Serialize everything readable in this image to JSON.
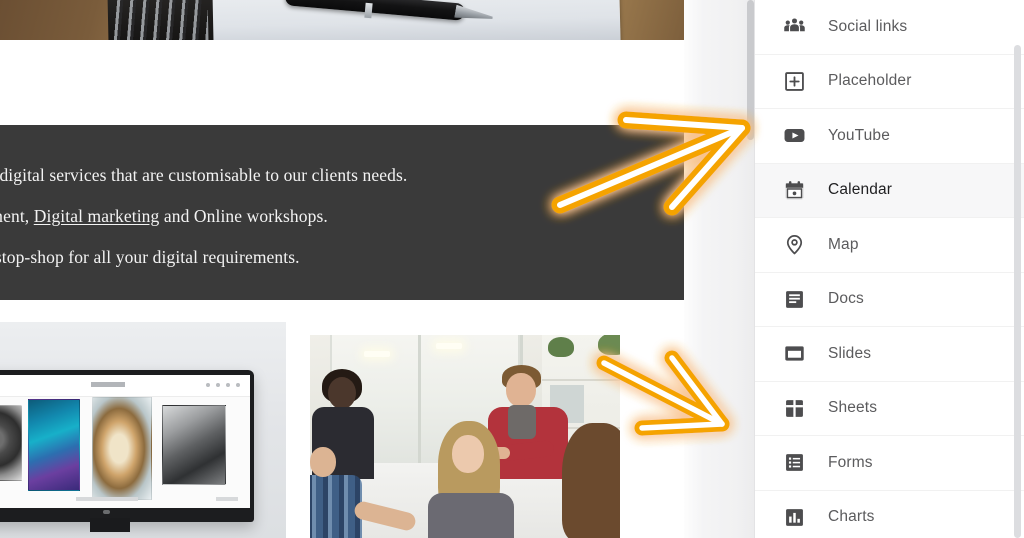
{
  "page_content": {
    "hero_photo": {
      "name": "desk-photo",
      "description": "notebook and pen on wooden desk"
    },
    "dark_band": {
      "lines": [
        "ons to vital digital services that are customisable to our clients needs.",
        "te development, ",
        "vide a one-stop-shop for all your digital requirements."
      ],
      "line2_link_text": "Digital marketing",
      "line2_suffix": " and Online workshops.",
      "background_color": "#3a3a3a",
      "text_color": "#f3f3f3"
    },
    "image_cards": [
      {
        "name": "monitor-artwork-photo",
        "caption": ""
      },
      {
        "name": "office-meeting-photo",
        "caption": ""
      }
    ]
  },
  "sidebar": {
    "selected_item": "Calendar",
    "items": [
      {
        "label": "Social links",
        "icon": "people-group-icon",
        "selected": false
      },
      {
        "label": "Placeholder",
        "icon": "plus-square-icon",
        "selected": false
      },
      {
        "label": "YouTube",
        "icon": "youtube-icon",
        "selected": false
      },
      {
        "label": "Calendar",
        "icon": "calendar-icon",
        "selected": true
      },
      {
        "label": "Map",
        "icon": "map-pin-icon",
        "selected": false
      },
      {
        "label": "Docs",
        "icon": "docs-icon",
        "selected": false
      },
      {
        "label": "Slides",
        "icon": "slides-icon",
        "selected": false
      },
      {
        "label": "Sheets",
        "icon": "sheets-icon",
        "selected": false
      },
      {
        "label": "Forms",
        "icon": "forms-icon",
        "selected": false
      },
      {
        "label": "Charts",
        "icon": "charts-icon",
        "selected": false
      }
    ]
  },
  "annotations": {
    "arrows": [
      {
        "name": "arrow-to-sidebar-top",
        "direction": "up-right",
        "color": "#f5a300",
        "core_color": "#ffffff"
      },
      {
        "name": "arrow-to-sidebar-bottom",
        "direction": "down-right",
        "color": "#f5a300",
        "core_color": "#ffffff"
      }
    ]
  },
  "colors": {
    "accent_orange": "#f5a300",
    "dark_band": "#3a3a3a",
    "sidebar_selected": "#f7f7f8",
    "sidebar_text": "#5b5b5d"
  }
}
